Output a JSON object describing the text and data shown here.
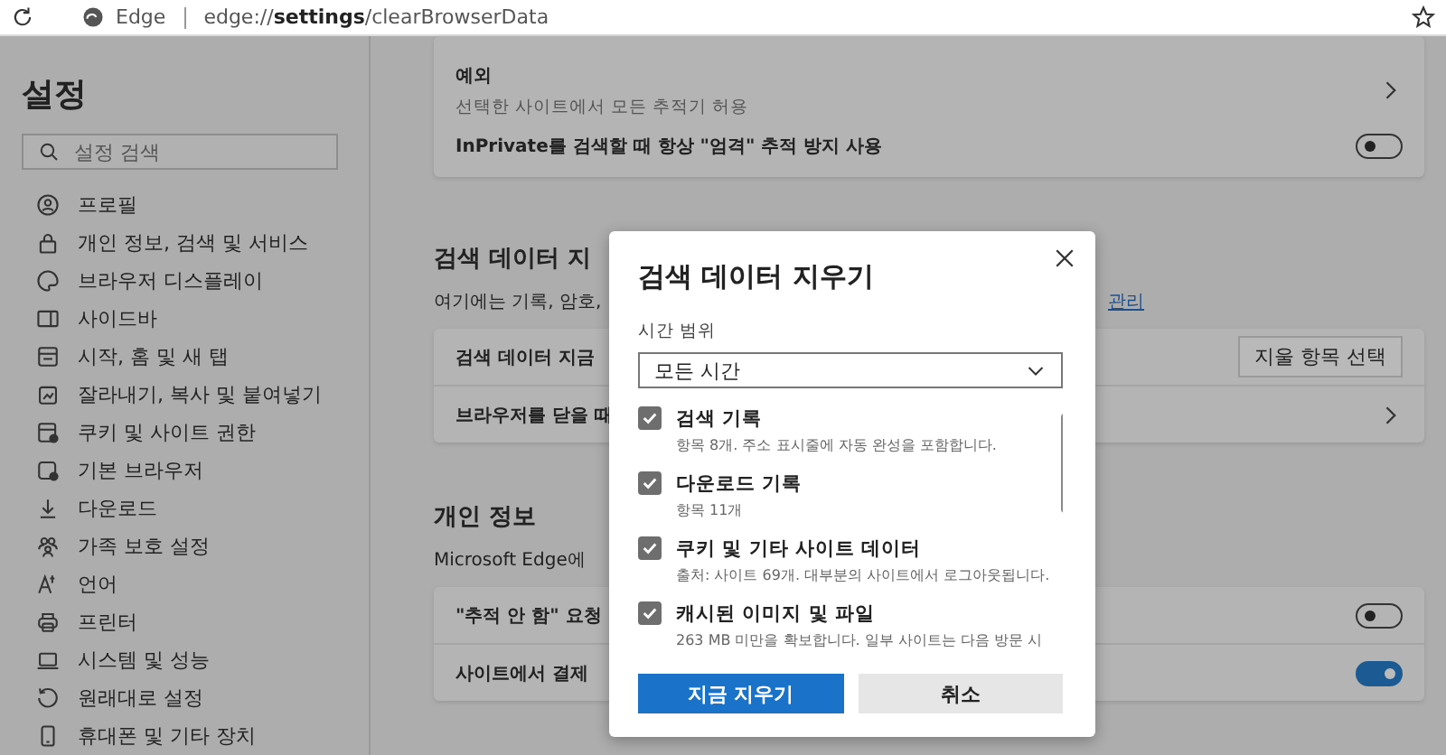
{
  "browser": {
    "site_label": "Edge",
    "url_prefix": "edge://",
    "url_bold": "settings",
    "url_rest": "/clearBrowserData"
  },
  "sidebar": {
    "title": "설정",
    "search": {
      "placeholder": "설정 검색"
    },
    "items": [
      {
        "label": "프로필"
      },
      {
        "label": "개인 정보, 검색 및 서비스"
      },
      {
        "label": "브라우저 디스플레이"
      },
      {
        "label": "사이드바"
      },
      {
        "label": "시작, 홈 및 새 탭"
      },
      {
        "label": "잘라내기, 복사 및 붙여넣기"
      },
      {
        "label": "쿠키 및 사이트 권한"
      },
      {
        "label": "기본 브라우저"
      },
      {
        "label": "다운로드"
      },
      {
        "label": "가족 보호 설정"
      },
      {
        "label": "언어"
      },
      {
        "label": "프린터"
      },
      {
        "label": "시스템 및 성능"
      },
      {
        "label": "원래대로 설정"
      },
      {
        "label": "휴대폰 및 기타 장치"
      }
    ]
  },
  "main": {
    "tracking_card": {
      "rows": [
        {
          "kind": "link",
          "title": "예외",
          "description": "선택한 사이트에서 모든 추적기 허용"
        },
        {
          "kind": "toggle",
          "title": "InPrivate를 검색할 때 항상 \"엄격\" 추적 방지 사용",
          "on": false
        }
      ]
    },
    "clear_section": {
      "heading": "검색 데이터 지",
      "description": "여기에는 기록, 암호,",
      "link": "관리",
      "rows": [
        {
          "kind": "button",
          "title": "검색 데이터 지금",
          "button": "지울 항목 선택"
        },
        {
          "kind": "link",
          "title": "브라우저를 닫을 때"
        }
      ]
    },
    "privacy_section": {
      "heading": "개인 정보",
      "description": "Microsoft Edge에",
      "rows": [
        {
          "kind": "toggle",
          "title": "\"추적 안 함\" 요청",
          "on": false
        },
        {
          "kind": "toggle",
          "title": "사이트에서 결제",
          "on": true
        }
      ]
    }
  },
  "dialog": {
    "title": "검색 데이터 지우기",
    "time_range_label": "시간 범위",
    "time_range_value": "모든 시간",
    "items": [
      {
        "title": "검색 기록",
        "description": "항목 8개. 주소 표시줄에 자동 완성을 포함합니다.",
        "checked": true
      },
      {
        "title": "다운로드 기록",
        "description": "항목 11개",
        "checked": true
      },
      {
        "title": "쿠키 및 기타 사이트 데이터",
        "description": "출처: 사이트 69개. 대부분의 사이트에서 로그아웃됩니다.",
        "checked": true
      },
      {
        "title": "캐시된 이미지 및 파일",
        "description": "263 MB 미만을 확보합니다. 일부 사이트는 다음 방문 시",
        "checked": true
      }
    ],
    "primary_button": "지금 지우기",
    "cancel_button": "취소"
  }
}
